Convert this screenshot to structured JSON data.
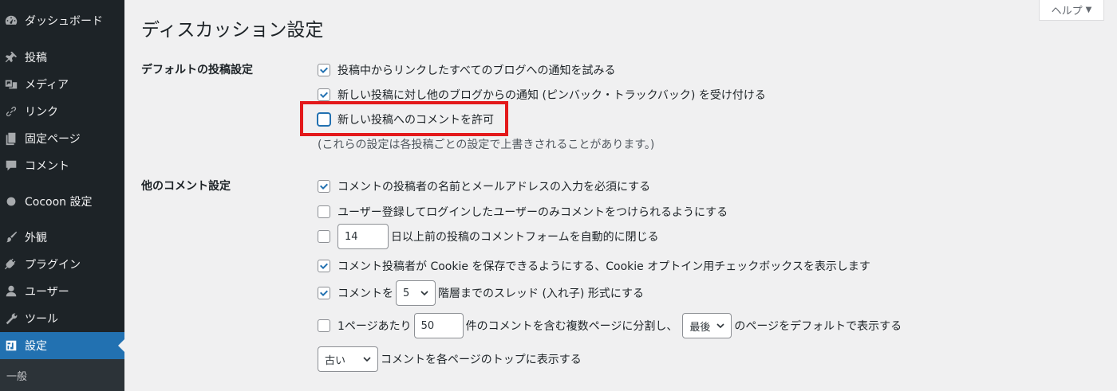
{
  "sidebar": {
    "items": [
      {
        "label": "ダッシュボード",
        "icon": "dashboard-icon"
      },
      {
        "label": "投稿",
        "icon": "pushpin-icon"
      },
      {
        "label": "メディア",
        "icon": "media-icon"
      },
      {
        "label": "リンク",
        "icon": "link-icon"
      },
      {
        "label": "固定ページ",
        "icon": "page-icon"
      },
      {
        "label": "コメント",
        "icon": "comment-icon"
      },
      {
        "label": "Cocoon 設定",
        "icon": "circle-icon"
      },
      {
        "label": "外観",
        "icon": "brush-icon"
      },
      {
        "label": "プラグイン",
        "icon": "plugin-icon"
      },
      {
        "label": "ユーザー",
        "icon": "user-icon"
      },
      {
        "label": "ツール",
        "icon": "wrench-icon"
      },
      {
        "label": "設定",
        "icon": "settings-icon",
        "active": true
      }
    ],
    "submenu": {
      "label": "一般"
    }
  },
  "header": {
    "title": "ディスカッション設定",
    "help_label": "ヘルプ",
    "help_arrow": "▼"
  },
  "default_post_settings": {
    "label": "デフォルトの投稿設定",
    "options": [
      {
        "label": "投稿中からリンクしたすべてのブログへの通知を試みる",
        "checked": true
      },
      {
        "label": "新しい投稿に対し他のブログからの通知 (ピンバック・トラックバック) を受け付ける",
        "checked": true
      },
      {
        "label": "新しい投稿へのコメントを許可",
        "checked": false
      }
    ],
    "note": "(これらの設定は各投稿ごとの設定で上書きされることがあります。)"
  },
  "other_comment_settings": {
    "label": "他のコメント設定",
    "require_name_email": {
      "label": "コメントの投稿者の名前とメールアドレスの入力を必須にする",
      "checked": true
    },
    "registration_required": {
      "label": "ユーザー登録してログインしたユーザーのみコメントをつけられるようにする",
      "checked": false
    },
    "close_comments": {
      "value": "14",
      "label": "日以上前の投稿のコメントフォームを自動的に閉じる",
      "checked": false
    },
    "cookies": {
      "label": "コメント投稿者が Cookie を保存できるようにする、Cookie オプトイン用チェックボックスを表示します",
      "checked": true
    },
    "threaded": {
      "prefix": "コメントを",
      "value": "5",
      "suffix": "階層までのスレッド (入れ子) 形式にする",
      "checked": true
    },
    "paged": {
      "prefix": "1ページあたり",
      "value": "50",
      "middle": "件のコメントを含む複数ページに分割し、",
      "select": "最後",
      "suffix": "のページをデフォルトで表示する",
      "checked": false
    },
    "order": {
      "select": "古い",
      "suffix": "コメントを各ページのトップに表示する"
    }
  },
  "colors": {
    "accent": "#2271b1",
    "sidebar_bg": "#1d2327",
    "highlight": "#e3191b"
  }
}
